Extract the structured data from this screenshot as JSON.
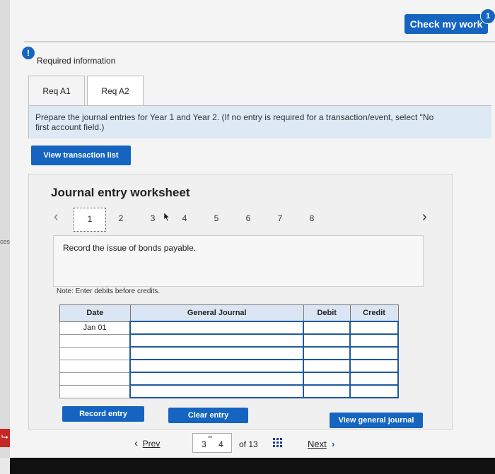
{
  "header": {
    "check_label": "Check my work",
    "badge_count": "1"
  },
  "info": {
    "icon_text": "!",
    "title": "Required information"
  },
  "tabs": [
    {
      "label": "Req A1"
    },
    {
      "label": "Req A2"
    }
  ],
  "instruction": {
    "line1_main": "Prepare the journal entries for Year 1 and Year 2. ",
    "line1_note": "(If no entry is required for a transaction/event, select \"No",
    "line2": "first account field.)"
  },
  "view_txn_label": "View transaction list",
  "worksheet": {
    "title": "Journal entry worksheet",
    "steps": [
      "1",
      "2",
      "3",
      "4",
      "5",
      "6",
      "7",
      "8"
    ],
    "description": "Record the issue of bonds payable.",
    "note": "Note: Enter debits before credits.",
    "columns": {
      "date": "Date",
      "journal": "General Journal",
      "debit": "Debit",
      "credit": "Credit"
    },
    "first_date": "Jan 01"
  },
  "buttons": {
    "record": "Record entry",
    "clear": "Clear entry",
    "view_journal": "View general journal"
  },
  "pager": {
    "prev": "Prev",
    "page_a": "3",
    "page_b": "4",
    "of": "of 13",
    "next": "Next"
  },
  "sidebar": {
    "text": "ces"
  },
  "colors": {
    "accent": "#1565c0",
    "instruction_bg": "#dde9f5",
    "alert": "#c62828"
  }
}
